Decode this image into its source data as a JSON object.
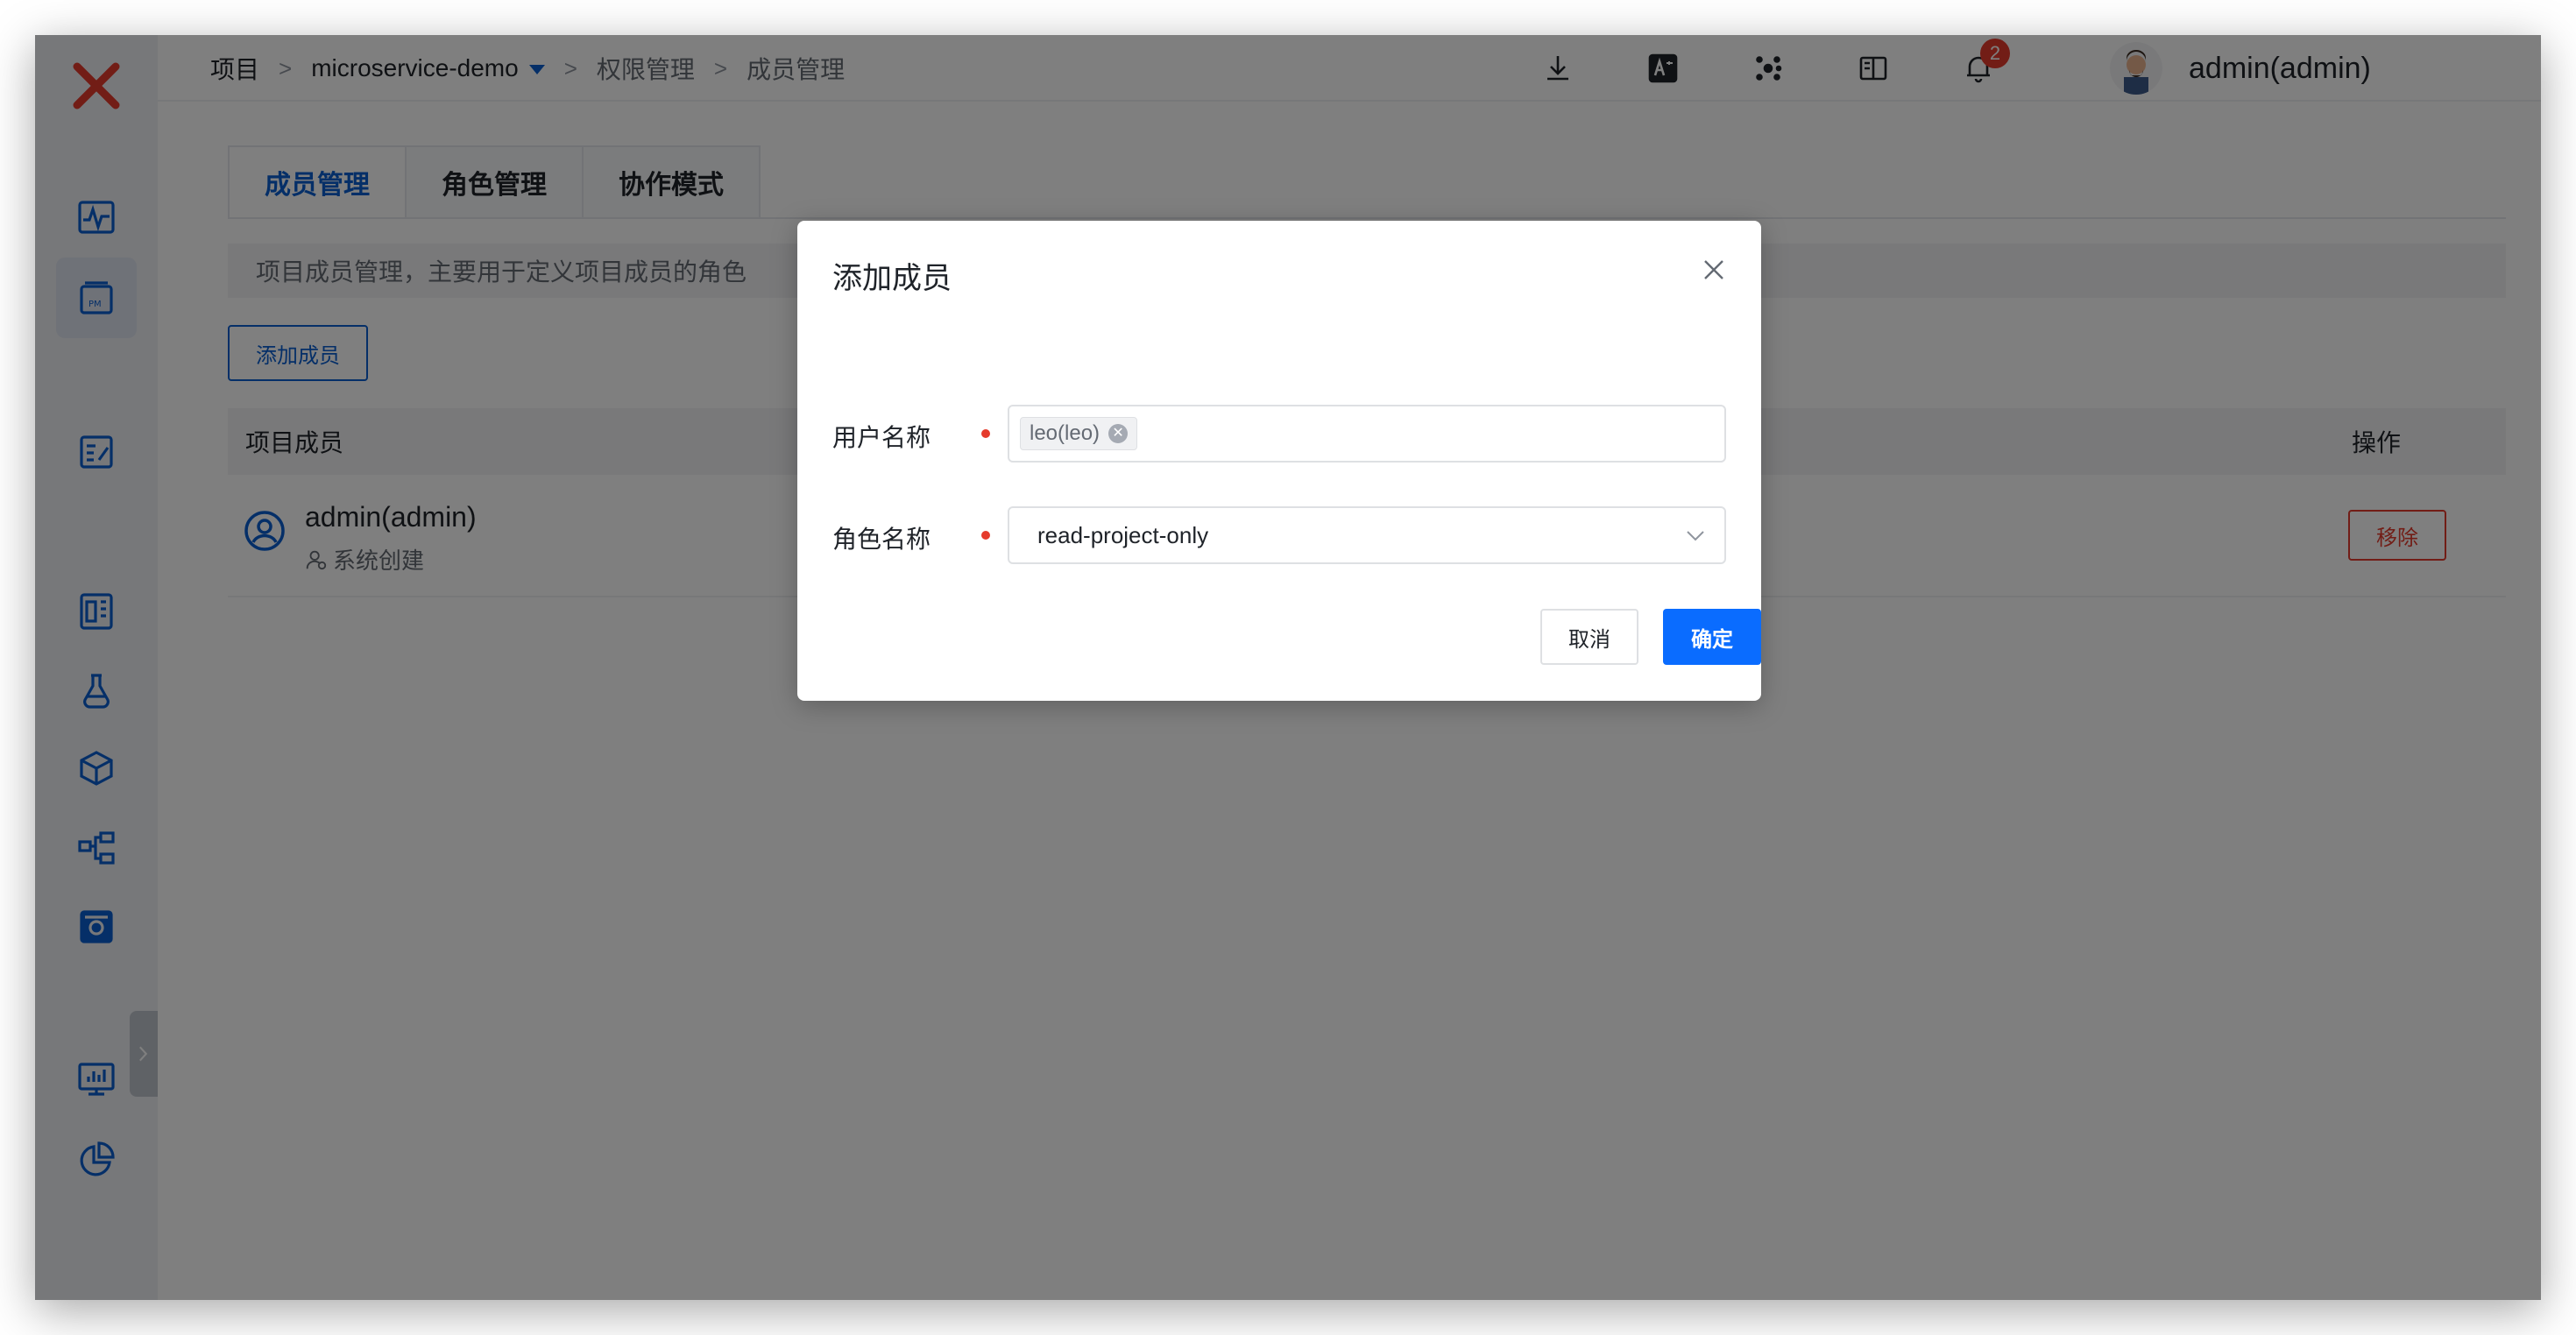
{
  "breadcrumb": {
    "root": "项目",
    "project": "microservice-demo",
    "section": "权限管理",
    "page": "成员管理",
    "separator": ">"
  },
  "topbar": {
    "icons": [
      "download-icon",
      "translate-icon",
      "scatter-icon",
      "book-icon",
      "bell-icon"
    ],
    "notification_count": "2",
    "username": "admin(admin)"
  },
  "sidebar": {
    "icons": [
      "activity-icon",
      "pm-icon",
      "edit-doc-icon",
      "dashboard-icon",
      "flask-icon",
      "package-icon",
      "workflow-icon",
      "settings-box-icon",
      "monitor-icon",
      "pie-chart-icon"
    ]
  },
  "tabs": [
    {
      "label": "成员管理"
    },
    {
      "label": "角色管理"
    },
    {
      "label": "协作模式"
    }
  ],
  "info_text": "项目成员管理，主要用于定义项目成员的角色",
  "add_member_button": "添加成员",
  "table": {
    "headers": {
      "member": "项目成员",
      "ops": "操作"
    },
    "rows": [
      {
        "name": "admin(admin)",
        "source": "系统创建",
        "action": "移除"
      }
    ]
  },
  "modal": {
    "title": "添加成员",
    "username_label": "用户名称",
    "username_tags": [
      "leo(leo)"
    ],
    "role_label": "角色名称",
    "role_value": "read-project-only",
    "cancel": "取消",
    "confirm": "确定"
  },
  "colors": {
    "accent": "#0a5fd0",
    "primary_button": "#0a6cff",
    "danger": "#e53b2c",
    "logo": "#e53b2c"
  }
}
